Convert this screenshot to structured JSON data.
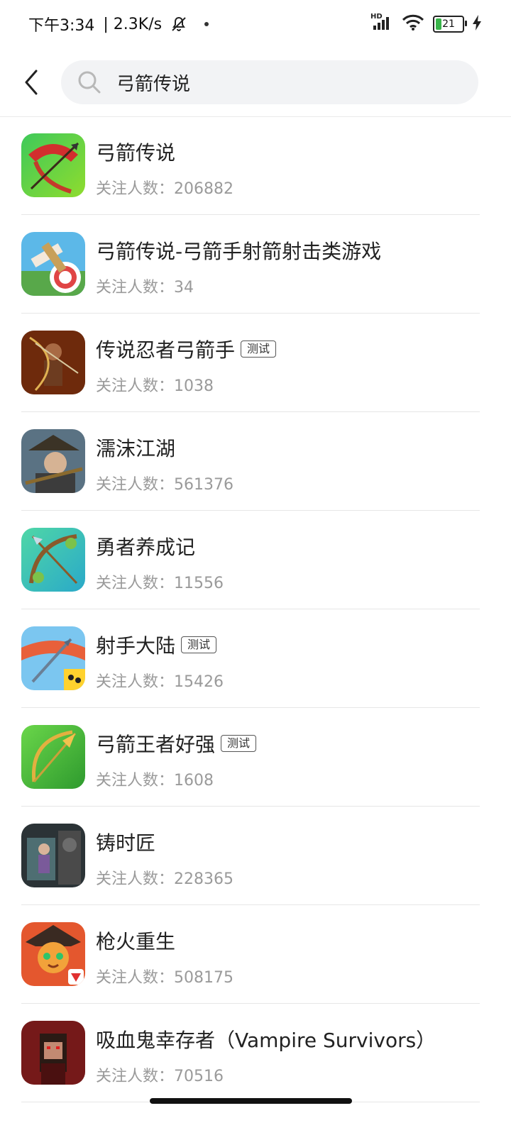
{
  "status_bar": {
    "time": "下午3:34",
    "speed": "| 2.3K/s",
    "network_label": "HD",
    "battery": "21"
  },
  "search": {
    "query": "弓箭传说"
  },
  "results": [
    {
      "title": "弓箭传说",
      "followers": "关注人数：206882",
      "badge": ""
    },
    {
      "title": "弓箭传说-弓箭手射箭射击类游戏",
      "followers": "关注人数：34",
      "badge": ""
    },
    {
      "title": "传说忍者弓箭手",
      "followers": "关注人数：1038",
      "badge": "测试"
    },
    {
      "title": "濡沫江湖",
      "followers": "关注人数：561376",
      "badge": ""
    },
    {
      "title": "勇者养成记",
      "followers": "关注人数：11556",
      "badge": ""
    },
    {
      "title": "射手大陆",
      "followers": "关注人数：15426",
      "badge": "测试"
    },
    {
      "title": "弓箭王者好强",
      "followers": "关注人数：1608",
      "badge": "测试"
    },
    {
      "title": "铸时匠",
      "followers": "关注人数：228365",
      "badge": ""
    },
    {
      "title": "枪火重生",
      "followers": "关注人数：508175",
      "badge": ""
    },
    {
      "title": "吸血鬼幸存者（Vampire Survivors）",
      "followers": "关注人数：70516",
      "badge": ""
    }
  ],
  "icons": {
    "back": "back-arrow-icon",
    "search": "search-icon",
    "notification_off": "bell-off-icon",
    "signal": "signal-icon",
    "wifi": "wifi-icon",
    "battery": "battery-icon",
    "charging": "charging-bolt-icon"
  }
}
